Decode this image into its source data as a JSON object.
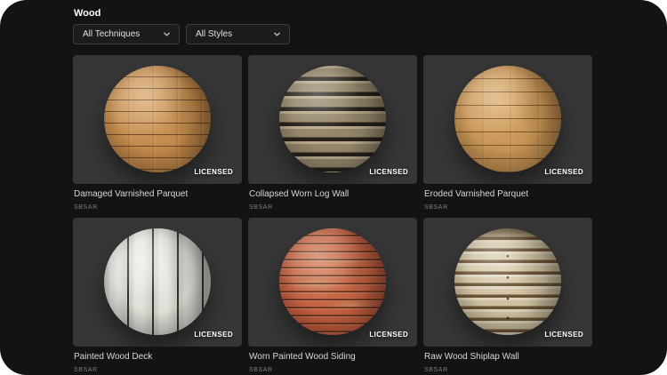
{
  "header": {
    "title": "Wood"
  },
  "filters": {
    "technique_dropdown": {
      "value": "All Techniques"
    },
    "style_dropdown": {
      "value": "All Styles"
    }
  },
  "materials": [
    {
      "title": "Damaged Varnished Parquet",
      "format": "SBSAR",
      "badge": "LICENSED",
      "colors": {
        "base": "#bd8447",
        "light": "#d9a668",
        "line": "#6e4a26"
      }
    },
    {
      "title": "Collapsed Worn Log Wall",
      "format": "SBSAR",
      "badge": "LICENSED",
      "colors": {
        "base": "#94866a",
        "light": "#b7a98b",
        "line": "#26211a"
      }
    },
    {
      "title": "Eroded Varnished Parquet",
      "format": "SBSAR",
      "badge": "LICENSED",
      "colors": {
        "base": "#c28f51",
        "light": "#ddad6e",
        "line": "#7c5529"
      }
    },
    {
      "title": "Painted Wood Deck",
      "format": "SBSAR",
      "badge": "LICENSED",
      "colors": {
        "base": "#d7d6ce",
        "light": "#efeeea",
        "line": "#34332c"
      }
    },
    {
      "title": "Worn Painted Wood Siding",
      "format": "SBSAR",
      "badge": "LICENSED",
      "colors": {
        "base": "#bc5a3d",
        "light": "#d1males",
        "line": "#552b18"
      }
    },
    {
      "title": "Raw Wood Shiplap Wall",
      "format": "SBSAR",
      "badge": "LICENSED",
      "colors": {
        "base": "#c6b898",
        "light": "#ded2b4",
        "line": "#6b5335"
      }
    }
  ],
  "theme": {
    "screen_background": "#131313",
    "card_background": "#363636",
    "dropdown_background": "#1c1c1c",
    "dropdown_border": "#3e3e3e",
    "title_color": "#d8d8d8",
    "subtitle_color": "#7d7d7d",
    "badge_color": "#ffffff"
  }
}
